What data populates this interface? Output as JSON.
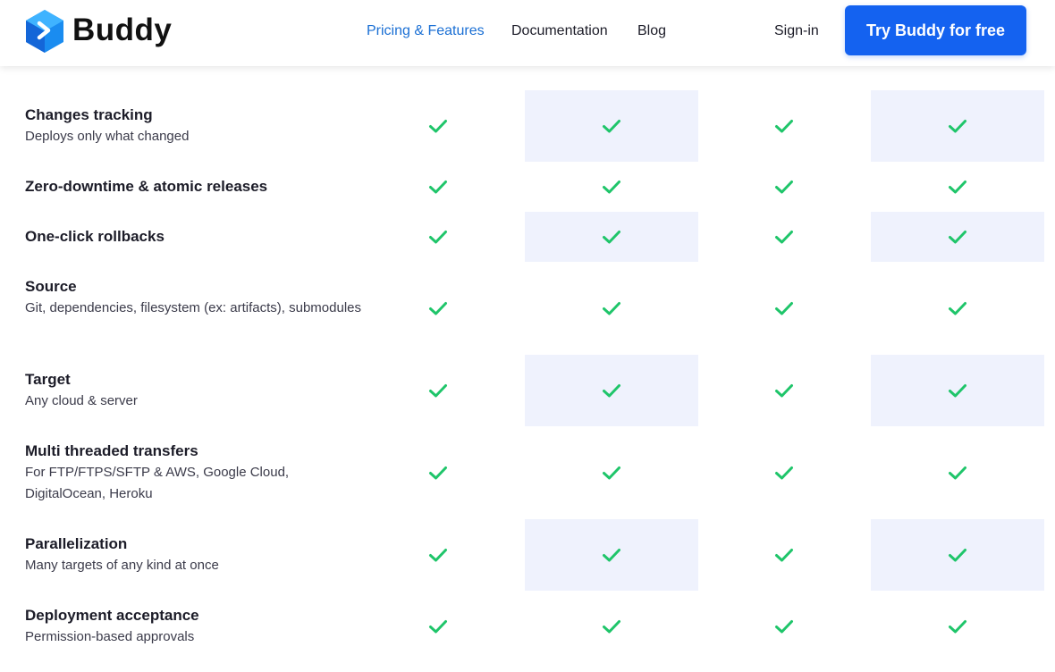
{
  "header": {
    "brand": "Buddy",
    "nav": [
      {
        "label": "Pricing & Features",
        "active": true
      },
      {
        "label": "Documentation",
        "active": false
      },
      {
        "label": "Blog",
        "active": false
      }
    ],
    "signin_label": "Sign-in",
    "cta_label": "Try Buddy for free"
  },
  "colors": {
    "accent": "#1462f0",
    "nav_active": "#1a6fd4",
    "check": "#1fc56a",
    "shaded_column": "#eff2fd"
  },
  "features": [
    {
      "title": "Changes tracking",
      "description": "Deploys only what changed",
      "plans": [
        true,
        true,
        true,
        true
      ]
    },
    {
      "title": "Zero-downtime & atomic releases",
      "description": "",
      "plans": [
        true,
        true,
        true,
        true
      ]
    },
    {
      "title": "One-click rollbacks",
      "description": "",
      "plans": [
        true,
        true,
        true,
        true
      ]
    },
    {
      "title": "Source",
      "description": "Git, dependencies, filesystem (ex: artifacts), submodules",
      "plans": [
        true,
        true,
        true,
        true
      ]
    },
    {
      "title": "Target",
      "description": "Any cloud & server",
      "plans": [
        true,
        true,
        true,
        true
      ]
    },
    {
      "title": "Multi threaded transfers",
      "description": "For FTP/FTPS/SFTP & AWS, Google Cloud, DigitalOcean, Heroku",
      "plans": [
        true,
        true,
        true,
        true
      ]
    },
    {
      "title": "Parallelization",
      "description": "Many targets of any kind at once",
      "plans": [
        true,
        true,
        true,
        true
      ]
    },
    {
      "title": "Deployment acceptance",
      "description": "Permission-based approvals",
      "plans": [
        true,
        true,
        true,
        true
      ]
    }
  ]
}
